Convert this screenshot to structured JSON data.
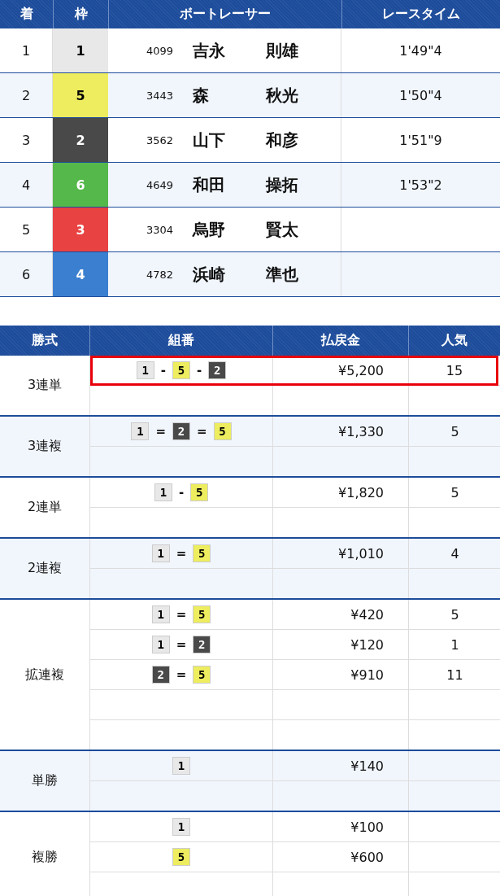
{
  "results": {
    "columns": [
      "着",
      "枠",
      "ボートレーサー",
      "レースタイム"
    ],
    "rows": [
      {
        "rank": "1",
        "frame": "1",
        "color": "#e8e8e8",
        "racer_id": "4099",
        "surname": "吉永",
        "given_name": "則雄",
        "time": "1'49\"4"
      },
      {
        "rank": "2",
        "frame": "5",
        "color": "#eded5f",
        "racer_id": "3443",
        "surname": "森",
        "given_name": "秋光",
        "time": "1'50\"4"
      },
      {
        "rank": "3",
        "frame": "2",
        "color": "#494949",
        "racer_id": "3562",
        "surname": "山下",
        "given_name": "和彦",
        "time": "1'51\"9"
      },
      {
        "rank": "4",
        "frame": "6",
        "color": "#55b84a",
        "racer_id": "4649",
        "surname": "和田",
        "given_name": "操拓",
        "time": "1'53\"2"
      },
      {
        "rank": "5",
        "frame": "3",
        "color": "#e84242",
        "racer_id": "3304",
        "surname": "烏野",
        "given_name": "賢太"
      },
      {
        "rank": "6",
        "frame": "4",
        "color": "#3b80d0",
        "racer_id": "4782",
        "surname": "浜崎",
        "given_name": "準也"
      }
    ]
  },
  "payouts": {
    "columns": [
      "勝式",
      "組番",
      "払戻金",
      "人気"
    ],
    "groups": [
      {
        "bet_type": "3連単",
        "rows": [
          {
            "highlighted": true,
            "separator": "-",
            "combo": [
              {
                "frame": "1",
                "color": "#e8e8e8"
              },
              {
                "frame": "5",
                "color": "#eded5f"
              },
              {
                "frame": "2",
                "color": "#494949"
              }
            ],
            "payout": "¥5,200",
            "popularity": "15"
          }
        ]
      },
      {
        "bet_type": "3連複",
        "rows": [
          {
            "highlighted": false,
            "separator": "=",
            "combo": [
              {
                "frame": "1",
                "color": "#e8e8e8"
              },
              {
                "frame": "2",
                "color": "#494949"
              },
              {
                "frame": "5",
                "color": "#eded5f"
              }
            ],
            "payout": "¥1,330",
            "popularity": "5"
          }
        ]
      },
      {
        "bet_type": "2連単",
        "rows": [
          {
            "highlighted": false,
            "separator": "-",
            "combo": [
              {
                "frame": "1",
                "color": "#e8e8e8"
              },
              {
                "frame": "5",
                "color": "#eded5f"
              }
            ],
            "payout": "¥1,820",
            "popularity": "5"
          }
        ]
      },
      {
        "bet_type": "2連複",
        "rows": [
          {
            "highlighted": false,
            "separator": "=",
            "combo": [
              {
                "frame": "1",
                "color": "#e8e8e8"
              },
              {
                "frame": "5",
                "color": "#eded5f"
              }
            ],
            "payout": "¥1,010",
            "popularity": "4"
          }
        ]
      },
      {
        "bet_type": "拡連複",
        "rows": [
          {
            "highlighted": false,
            "separator": "=",
            "combo": [
              {
                "frame": "1",
                "color": "#e8e8e8"
              },
              {
                "frame": "5",
                "color": "#eded5f"
              }
            ],
            "payout": "¥420",
            "popularity": "5"
          },
          {
            "highlighted": false,
            "separator": "=",
            "combo": [
              {
                "frame": "1",
                "color": "#e8e8e8"
              },
              {
                "frame": "2",
                "color": "#494949"
              }
            ],
            "payout": "¥120",
            "popularity": "1"
          },
          {
            "highlighted": false,
            "separator": "=",
            "combo": [
              {
                "frame": "2",
                "color": "#494949"
              },
              {
                "frame": "5",
                "color": "#eded5f"
              }
            ],
            "payout": "¥910",
            "popularity": "11"
          }
        ]
      },
      {
        "bet_type": "単勝",
        "rows": [
          {
            "highlighted": false,
            "combo": [
              {
                "frame": "1",
                "color": "#e8e8e8"
              }
            ],
            "payout": "¥140"
          }
        ]
      },
      {
        "bet_type": "複勝",
        "rows": [
          {
            "highlighted": false,
            "combo": [
              {
                "frame": "1",
                "color": "#e8e8e8"
              }
            ],
            "payout": "¥100"
          },
          {
            "highlighted": false,
            "combo": [
              {
                "frame": "5",
                "color": "#eded5f"
              }
            ],
            "payout": "¥600"
          }
        ]
      }
    ]
  }
}
